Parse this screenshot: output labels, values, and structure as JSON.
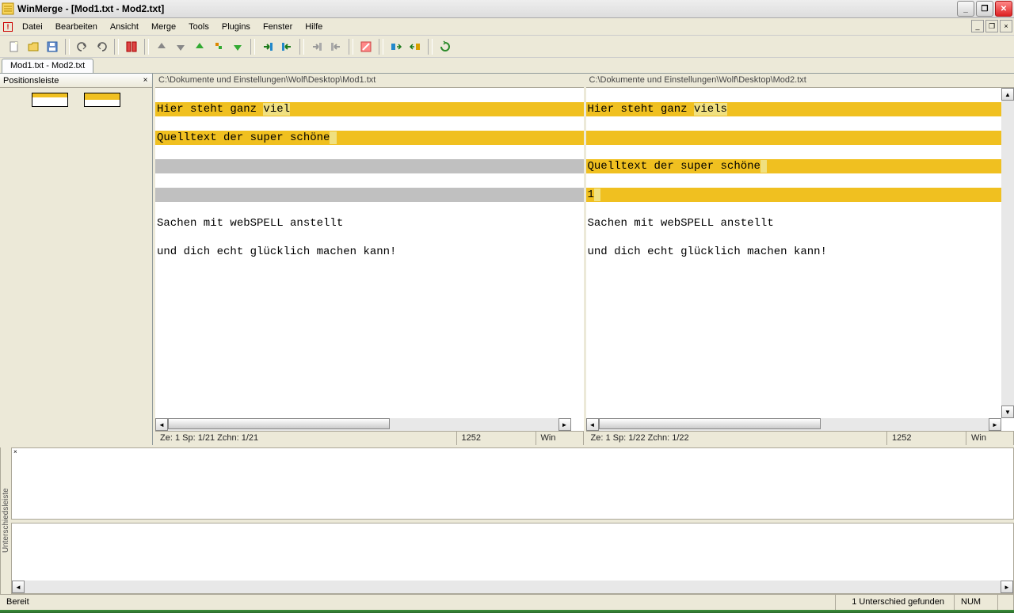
{
  "title": "WinMerge - [Mod1.txt - Mod2.txt]",
  "menu": {
    "datei": "Datei",
    "bearbeiten": "Bearbeiten",
    "ansicht": "Ansicht",
    "merge": "Merge",
    "tools": "Tools",
    "plugins": "Plugins",
    "fenster": "Fenster",
    "hilfe": "Hilfe"
  },
  "doctab": "Mod1.txt - Mod2.txt",
  "location_header": "Positionsleiste",
  "left": {
    "path": "C:\\Dokumente und Einstellungen\\Wolf\\Desktop\\Mod1.txt",
    "line1a": "Hier steht ganz ",
    "line1b": "viel",
    "line1c": "",
    "line2": "Quelltext der super schöne",
    "line3": "Sachen mit webSPELL anstellt",
    "line4": "und dich echt glücklich machen kann!",
    "stat_pos": "Ze: 1  Sp: 1/21  Zchn: 1/21",
    "stat_cp": "1252",
    "stat_eol": "Win"
  },
  "right": {
    "path": "C:\\Dokumente und Einstellungen\\Wolf\\Desktop\\Mod2.txt",
    "line1a": "Hier steht ganz ",
    "line1b": "viels",
    "line1c": "",
    "line2": "Quelltext der super schöne",
    "lineextra": "1",
    "line3": "Sachen mit webSPELL anstellt",
    "line4": "und dich echt glücklich machen kann!",
    "stat_pos": "Ze: 1  Sp: 1/22  Zchn: 1/22",
    "stat_cp": "1252",
    "stat_eol": "Win"
  },
  "diff_sidebar": "Unterschiedsleiste",
  "status": {
    "ready": "Bereit",
    "diffs": "1 Unterschied gefunden",
    "num": "NUM"
  }
}
